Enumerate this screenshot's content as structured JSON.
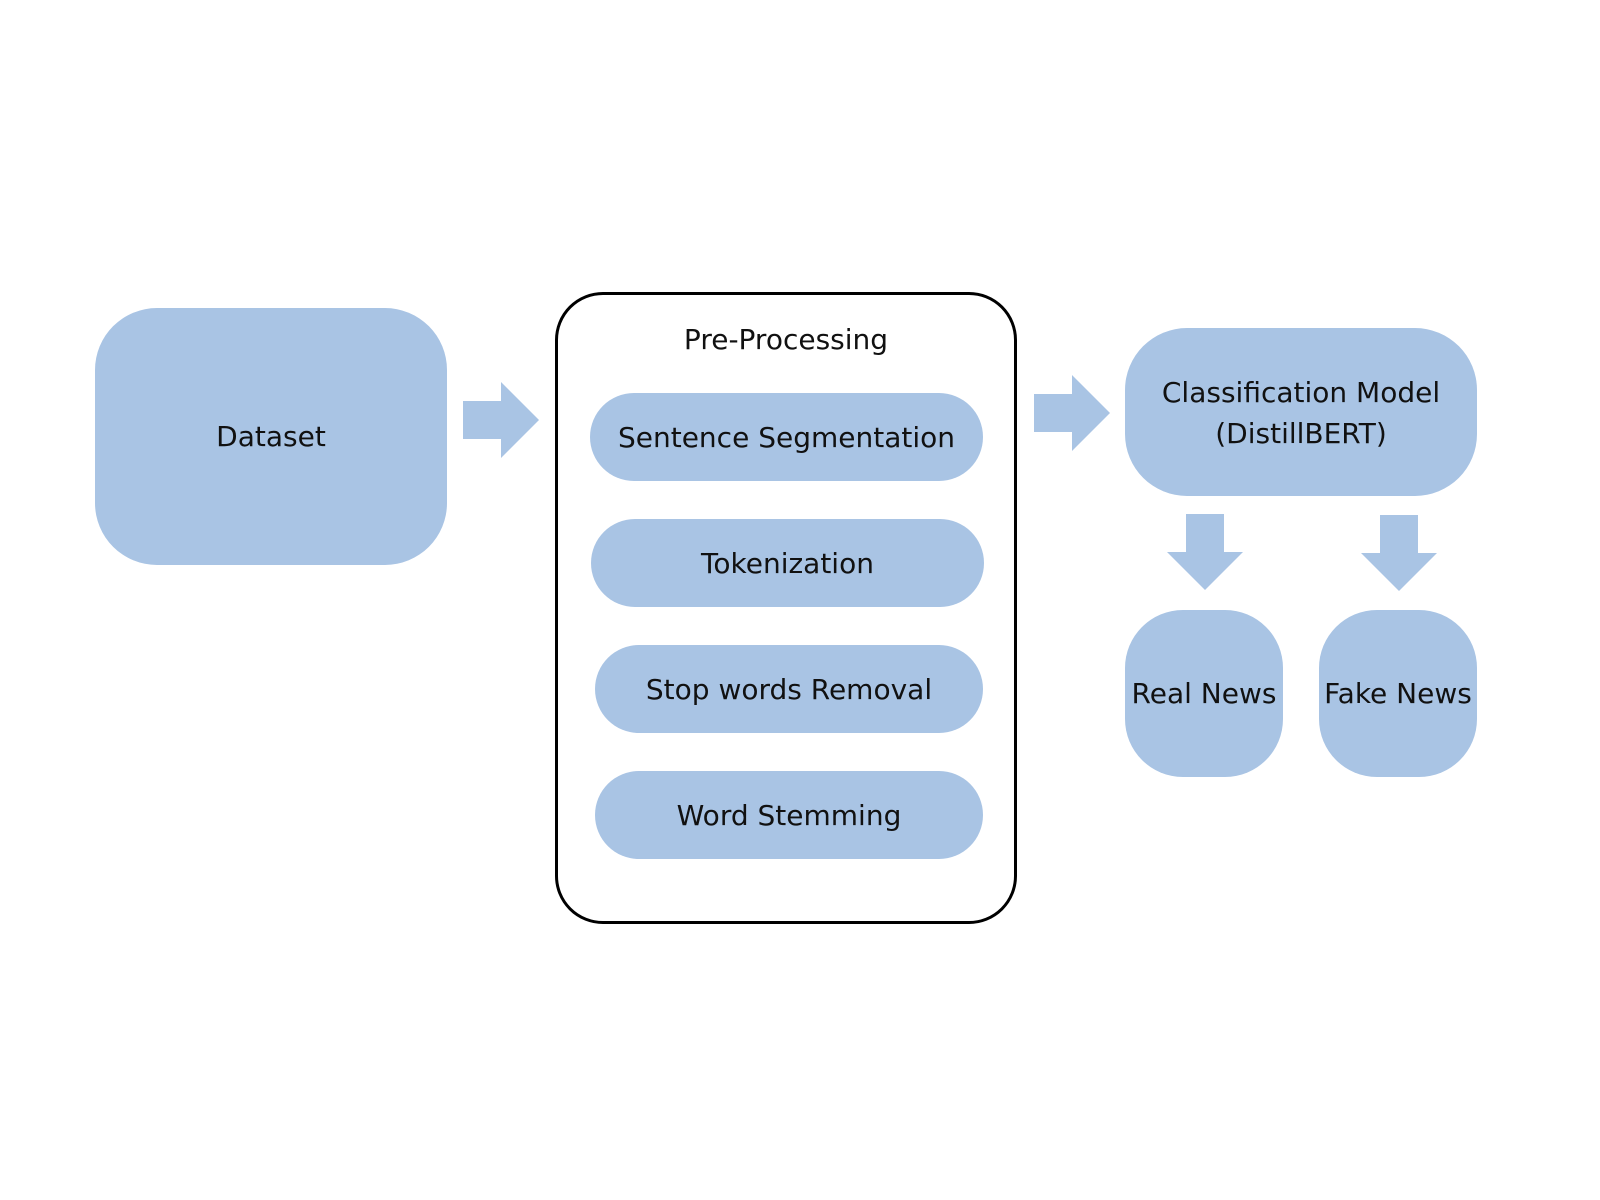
{
  "diagram": {
    "fill_color": "#a9c4e4",
    "border_color": "#000000",
    "nodes": {
      "dataset": "Dataset",
      "preprocessing_title": "Pre-Processing",
      "steps": [
        "Sentence Segmentation",
        "Tokenization",
        "Stop words Removal",
        "Word Stemming"
      ],
      "model_line1": "Classification Model",
      "model_line2": "(DistillBERT)",
      "real": "Real News",
      "fake": "Fake News"
    },
    "edges": [
      {
        "from": "Dataset",
        "to": "Pre-Processing"
      },
      {
        "from": "Pre-Processing",
        "to": "Classification Model (DistillBERT)"
      },
      {
        "from": "Classification Model (DistillBERT)",
        "to": "Real News"
      },
      {
        "from": "Classification Model (DistillBERT)",
        "to": "Fake News"
      }
    ]
  }
}
